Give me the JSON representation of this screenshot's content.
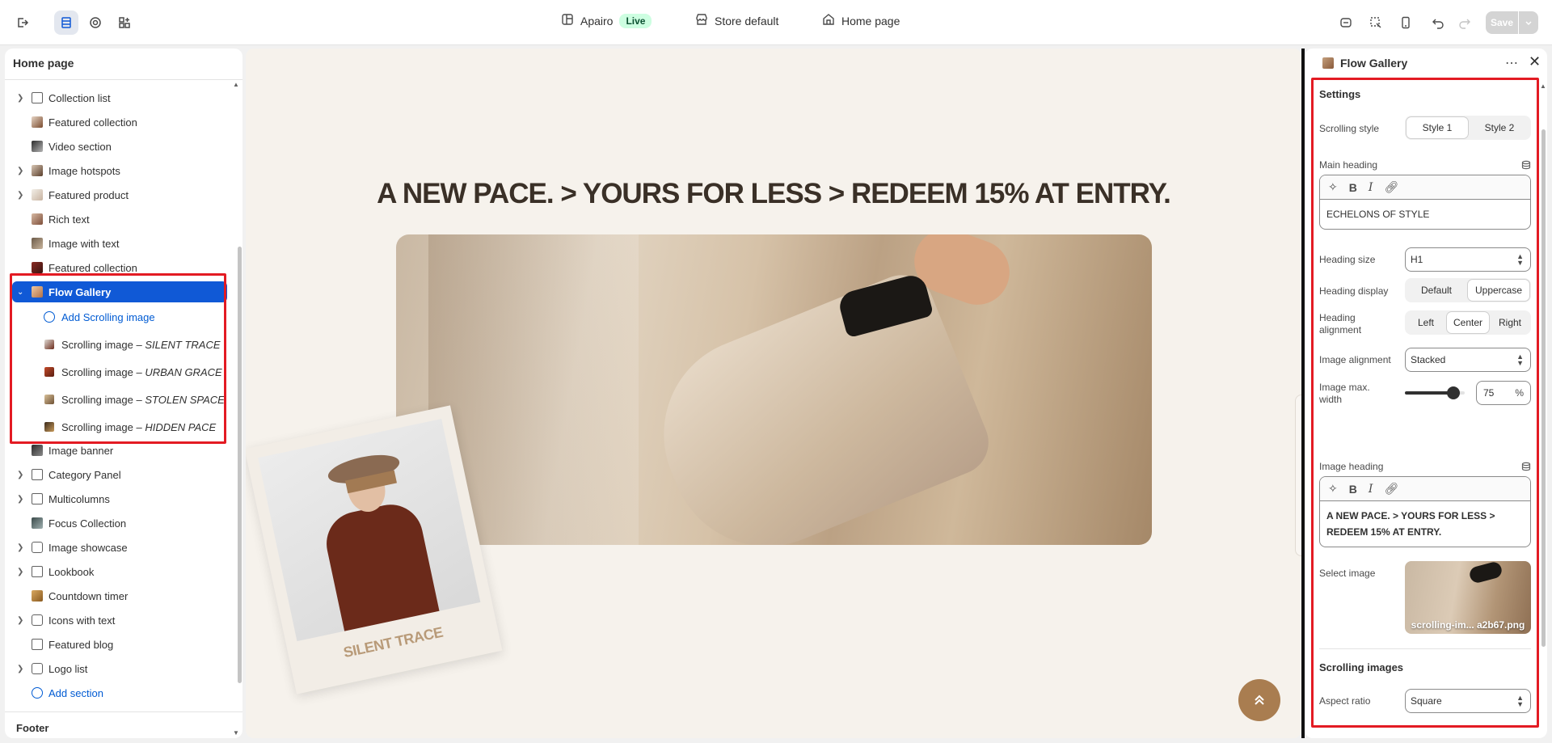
{
  "topbar": {
    "store_name": "Apairo",
    "live_label": "Live",
    "theme_label": "Store default",
    "page_label": "Home page",
    "save_label": "Save"
  },
  "left_panel": {
    "title": "Home page",
    "items": [
      {
        "label": "Collection list",
        "chevron": true,
        "icon": "grid-icon"
      },
      {
        "label": "Featured collection",
        "chevron": false,
        "icon": "thumb-icon"
      },
      {
        "label": "Video section",
        "chevron": false,
        "icon": "thumb-icon"
      },
      {
        "label": "Image hotspots",
        "chevron": true,
        "icon": "thumb-icon"
      },
      {
        "label": "Featured product",
        "chevron": true,
        "icon": "thumb-icon"
      },
      {
        "label": "Rich text",
        "chevron": false,
        "icon": "thumb-icon"
      },
      {
        "label": "Image with text",
        "chevron": false,
        "icon": "thumb-icon"
      },
      {
        "label": "Featured collection",
        "chevron": false,
        "icon": "thumb-icon"
      },
      {
        "label": "Flow Gallery",
        "chevron": true,
        "icon": "thumb-icon",
        "selected": true
      }
    ],
    "flow_children": {
      "add_label": "Add Scrolling image",
      "images": [
        {
          "prefix": "Scrolling image – ",
          "name": "SILENT TRACE"
        },
        {
          "prefix": "Scrolling image – ",
          "name": "URBAN GRACE"
        },
        {
          "prefix": "Scrolling image – ",
          "name": "STOLEN SPACE"
        },
        {
          "prefix": "Scrolling image – ",
          "name": "HIDDEN PACE"
        }
      ]
    },
    "after_items": [
      {
        "label": "Image banner",
        "chevron": false
      },
      {
        "label": "Category Panel",
        "chevron": true
      },
      {
        "label": "Multicolumns",
        "chevron": true
      },
      {
        "label": "Focus Collection",
        "chevron": false
      },
      {
        "label": "Image showcase",
        "chevron": true
      },
      {
        "label": "Lookbook",
        "chevron": true
      },
      {
        "label": "Countdown timer",
        "chevron": false
      },
      {
        "label": "Icons with text",
        "chevron": true
      },
      {
        "label": "Featured blog",
        "chevron": false
      },
      {
        "label": "Logo list",
        "chevron": true
      }
    ],
    "add_section_label": "Add section",
    "footer_label": "Footer"
  },
  "preview": {
    "heading": "A NEW PACE. > YOURS FOR LESS > REDEEM 15% AT ENTRY.",
    "polaroid_caption": "SILENT TRACE"
  },
  "right_panel": {
    "title": "Flow Gallery",
    "settings_title": "Settings",
    "scrolling_style": {
      "label": "Scrolling style",
      "options": [
        "Style 1",
        "Style 2"
      ],
      "selected": "Style 1"
    },
    "main_heading": {
      "label": "Main heading",
      "value": "ECHELONS OF STYLE"
    },
    "heading_size": {
      "label": "Heading size",
      "value": "H1"
    },
    "heading_display": {
      "label": "Heading display",
      "options": [
        "Default",
        "Uppercase"
      ],
      "selected": "Uppercase"
    },
    "heading_alignment": {
      "label": "Heading alignment",
      "options": [
        "Left",
        "Center",
        "Right"
      ],
      "selected": "Center"
    },
    "image_alignment": {
      "label": "Image alignment",
      "value": "Stacked"
    },
    "image_max_width": {
      "label": "Image max. width",
      "value": "75",
      "unit": "%"
    },
    "image_heading": {
      "label": "Image heading",
      "value": "A NEW PACE. > YOURS FOR LESS > REDEEM 15% AT ENTRY."
    },
    "select_image": {
      "label": "Select image",
      "filename": "scrolling-im... a2b67.png"
    },
    "scrolling_images_title": "Scrolling images",
    "aspect_ratio": {
      "label": "Aspect ratio",
      "value": "Square"
    }
  },
  "colors": {
    "accent": "#1059d6",
    "highlight": "#e31b23",
    "live_bg": "#cdfee1",
    "preview_bg": "#f6f2ec"
  }
}
